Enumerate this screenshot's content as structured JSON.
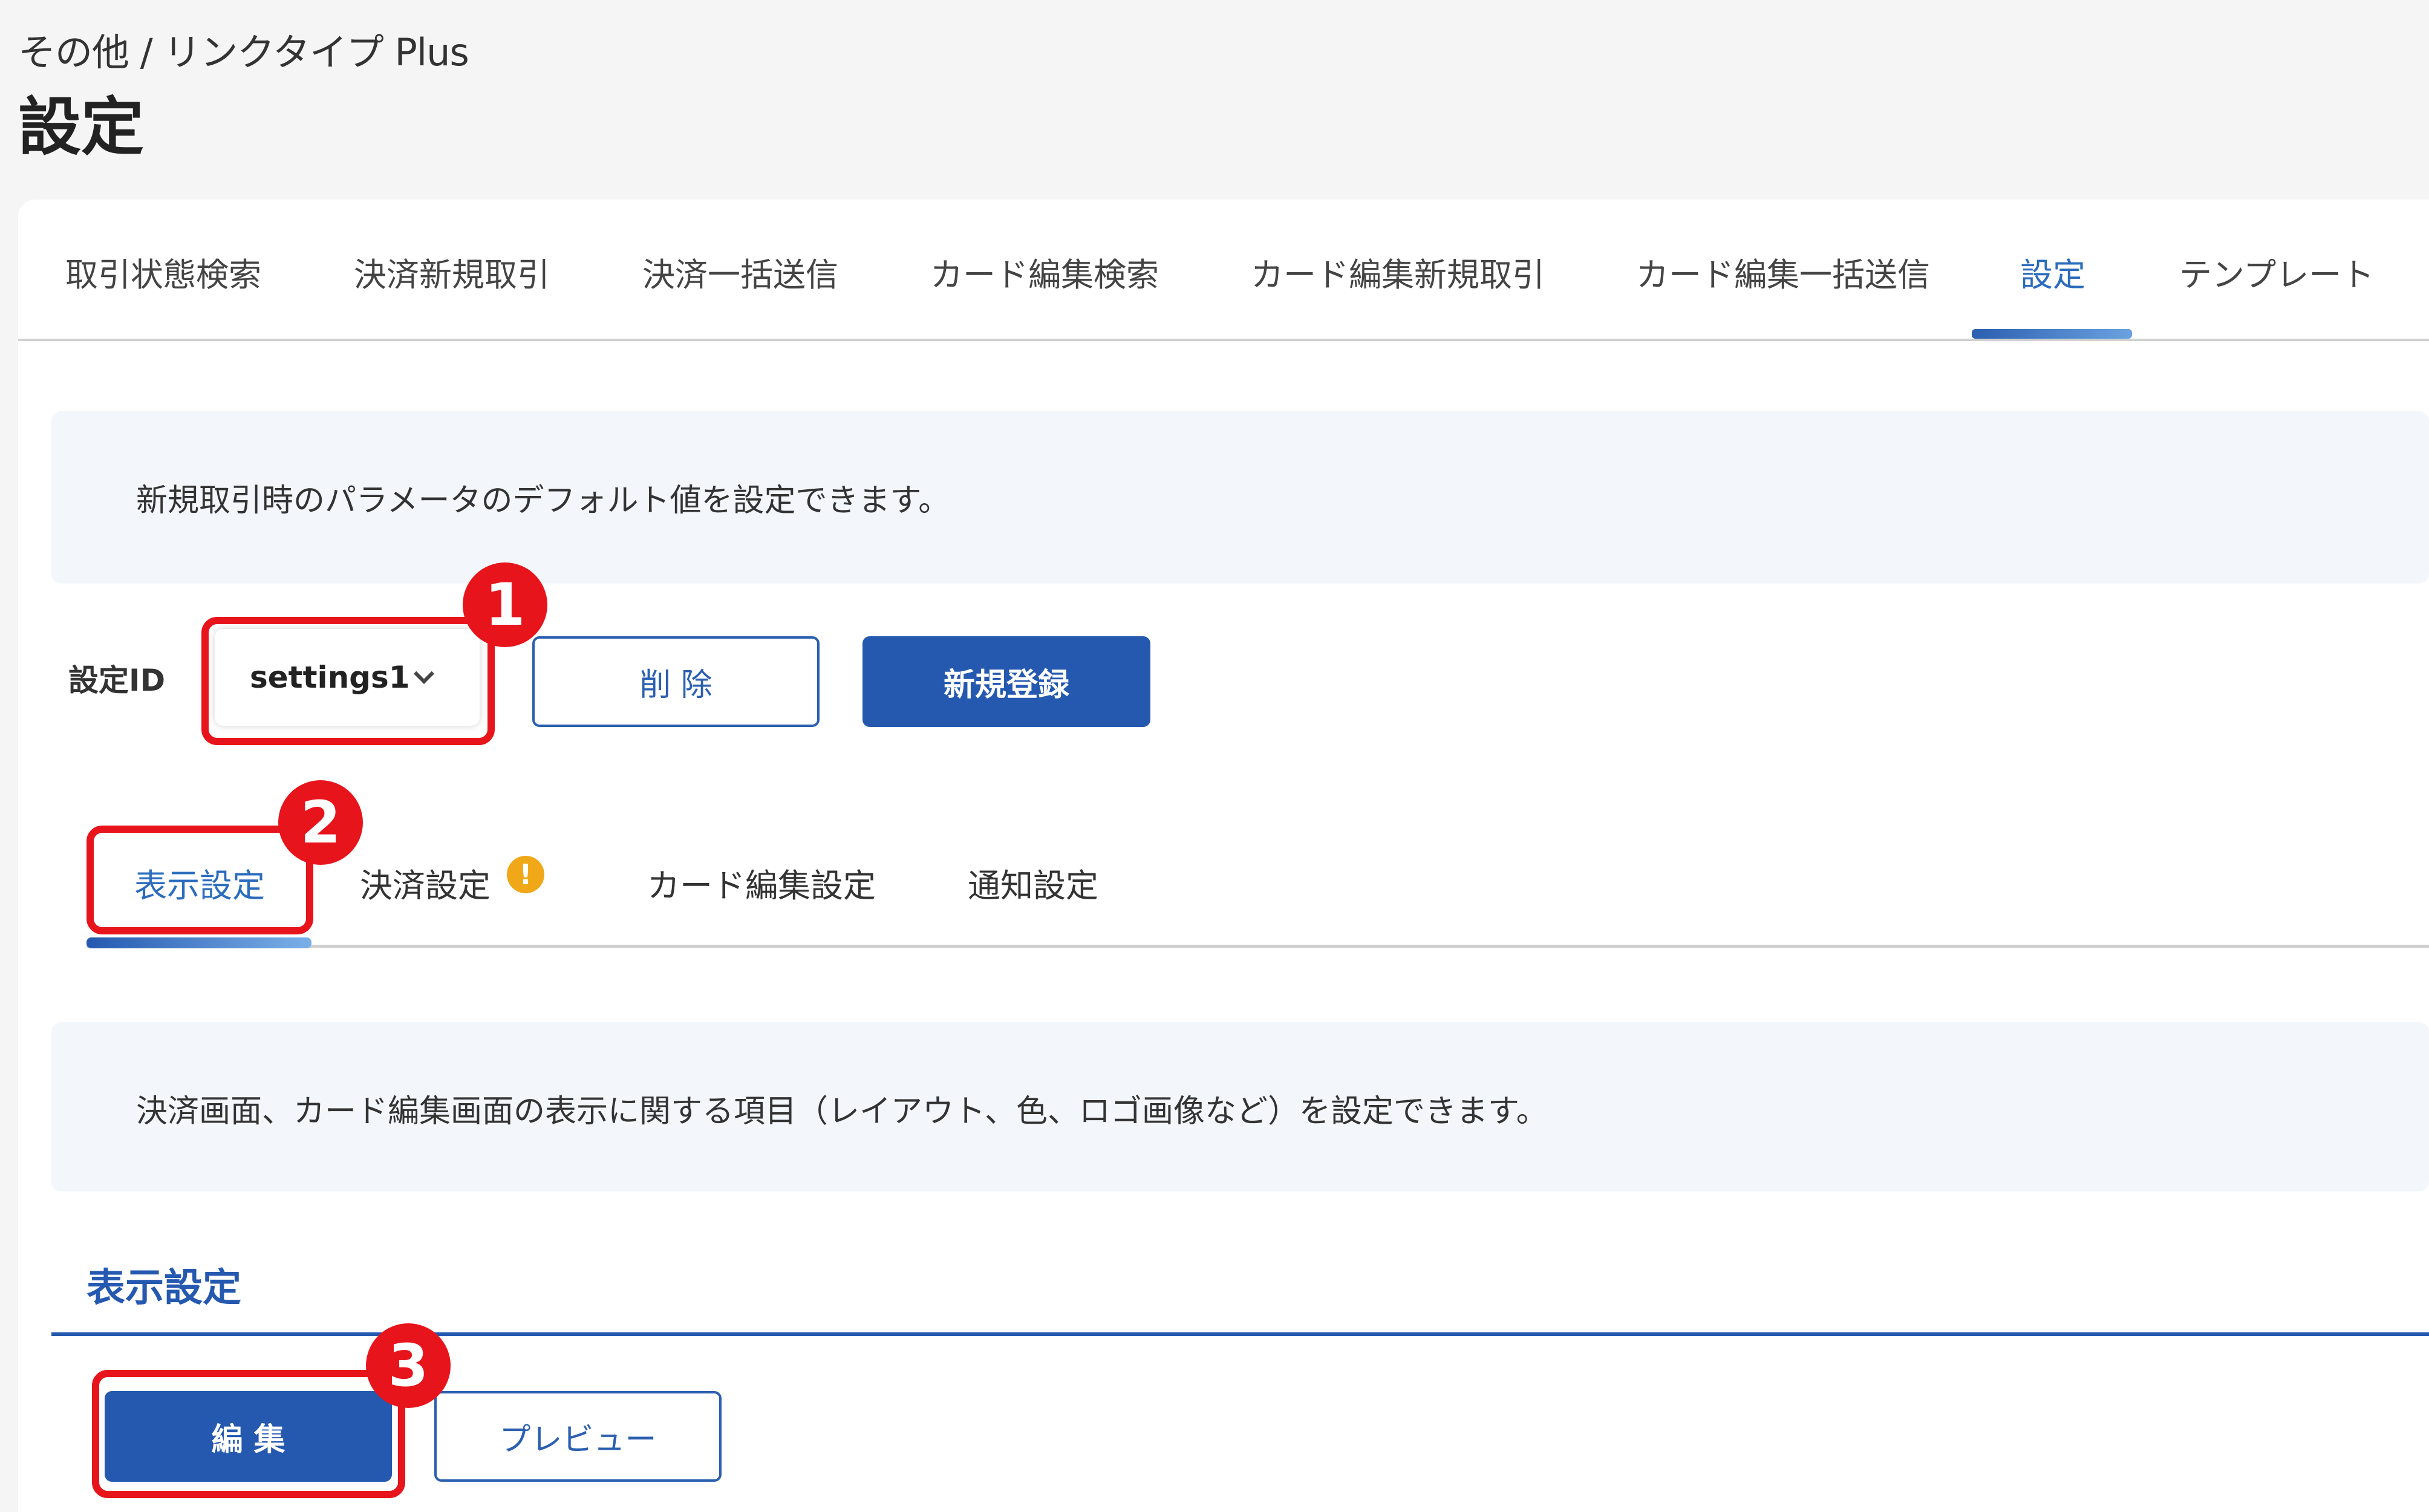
{
  "header": {
    "breadcrumb": "その他 / リンクタイプ Plus",
    "title": "設定"
  },
  "main_tabs": [
    {
      "label": "取引状態検索"
    },
    {
      "label": "決済新規取引"
    },
    {
      "label": "決済一括送信"
    },
    {
      "label": "カード編集検索"
    },
    {
      "label": "カード編集新規取引"
    },
    {
      "label": "カード編集一括送信"
    },
    {
      "label": "設定",
      "active": true
    },
    {
      "label": "テンプレート"
    }
  ],
  "top_info": "新規取引時のパラメータのデフォルト値を設定できます。",
  "settings": {
    "id_label": "設定ID",
    "selected_id": "settings1",
    "delete_label": "削 除",
    "register_label": "新規登録"
  },
  "sub_tabs": [
    {
      "label": "表示設定",
      "active": true
    },
    {
      "label": "決済設定",
      "warning": true
    },
    {
      "label": "カード編集設定"
    },
    {
      "label": "通知設定"
    }
  ],
  "warning_glyph": "!",
  "display_info": "決済画面、カード編集画面の表示に関する項目（レイアウト、色、ロゴ画像など）を設定できます。",
  "section": {
    "title": "表示設定",
    "edit_label": "編 集",
    "preview_label": "プレビュー"
  },
  "annotations": {
    "badges": [
      "1",
      "2",
      "3"
    ],
    "highlight_color": "#e8141c"
  },
  "colors": {
    "accent": "#2559b0",
    "warning": "#f0a818"
  }
}
